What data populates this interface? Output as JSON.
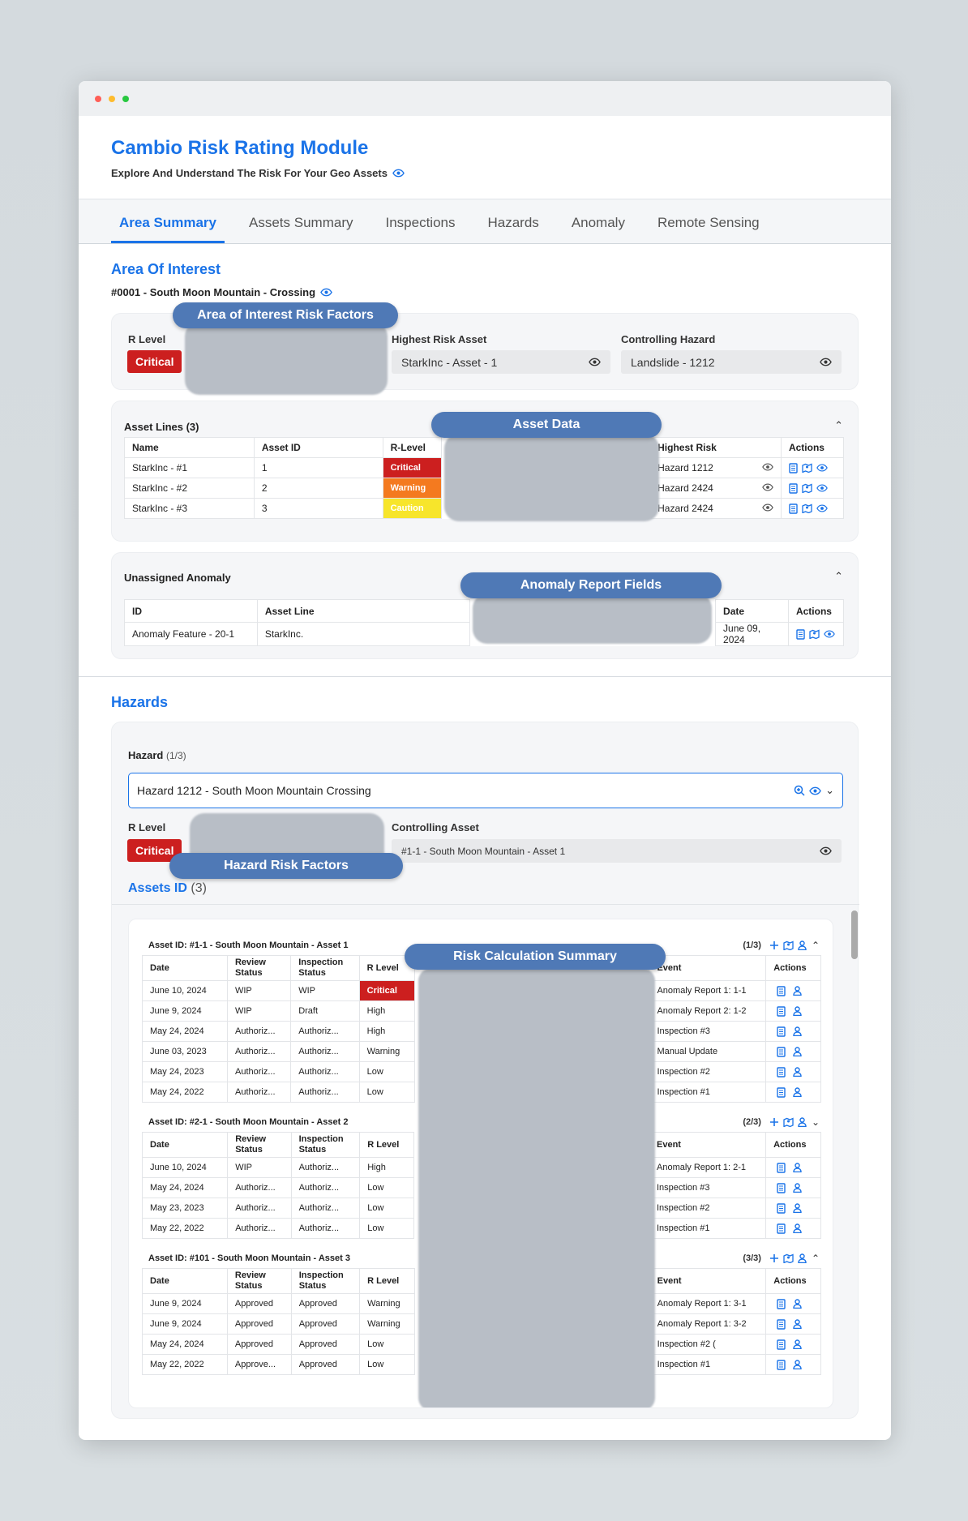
{
  "app": {
    "title": "Cambio Risk Rating Module",
    "subtitle": "Explore And Understand The Risk For Your Geo Assets"
  },
  "tabs": [
    "Area Summary",
    "Assets Summary",
    "Inspections",
    "Hazards",
    "Anomaly",
    "Remote Sensing"
  ],
  "aoi": {
    "heading": "Area Of Interest",
    "name": "#0001 - South Moon Mountain - Crossing",
    "r_level_label": "R Level",
    "r_level_value": "Critical",
    "highest_risk_asset_label": "Highest Risk Asset",
    "highest_risk_asset_value": "StarkInc - Asset - 1",
    "controlling_hazard_label": "Controlling Hazard",
    "controlling_hazard_value": "Landslide - 1212",
    "overlay": "Area of Interest Risk Factors"
  },
  "asset_lines": {
    "title": "Asset Lines (3)",
    "overlay": "Asset Data",
    "headers": [
      "Name",
      "Asset ID",
      "R-Level",
      "Highest Risk",
      "Actions"
    ],
    "rows": [
      {
        "name": "StarkInc - #1",
        "id": "1",
        "rlevel": "Critical",
        "highest": "Hazard 1212"
      },
      {
        "name": "StarkInc - #2",
        "id": "2",
        "rlevel": "Warning",
        "highest": "Hazard 2424"
      },
      {
        "name": "StarkInc - #3",
        "id": "3",
        "rlevel": "Caution",
        "highest": "Hazard 2424"
      }
    ]
  },
  "anomaly": {
    "title": "Unassigned Anomaly",
    "overlay": "Anomaly Report Fields",
    "headers": [
      "ID",
      "Asset Line",
      "Date",
      "Actions"
    ],
    "rows": [
      {
        "id": "Anomaly Feature - 20-1",
        "line": "StarkInc.",
        "date": "June 09, 2024"
      }
    ]
  },
  "hazards": {
    "heading": "Hazards",
    "hazard_label": "Hazard",
    "hazard_count": "(1/3)",
    "select_value": "Hazard 1212 - South Moon Mountain Crossing",
    "r_level_label": "R Level",
    "r_level_value": "Critical",
    "controlling_asset_label": "Controlling Asset",
    "controlling_asset_value": "#1-1 - South Moon Mountain - Asset 1",
    "overlay": "Hazard Risk Factors",
    "assets_id_label": "Assets ID",
    "assets_id_count": "(3)",
    "risk_overlay": "Risk Calculation Summary"
  },
  "asset_tables": [
    {
      "title": "Asset ID: #1-1 - South Moon Mountain - Asset 1",
      "count": "(1/3)",
      "expanded": true,
      "rows": [
        {
          "date": "June 10, 2024",
          "review": "WIP",
          "insp": "WIP",
          "rlevel": "Critical",
          "event": "Anomaly Report 1: 1-1"
        },
        {
          "date": "June 9, 2024",
          "review": "WIP",
          "insp": "Draft",
          "rlevel": "High",
          "event": "Anomaly Report 2: 1-2"
        },
        {
          "date": "May 24, 2024",
          "review": "Authoriz...",
          "insp": "Authoriz...",
          "rlevel": "High",
          "event": "Inspection #3"
        },
        {
          "date": "June 03, 2023",
          "review": "Authoriz...",
          "insp": "Authoriz...",
          "rlevel": "Warning",
          "event": "Manual Update"
        },
        {
          "date": "May 24, 2023",
          "review": "Authoriz...",
          "insp": "Authoriz...",
          "rlevel": "Low",
          "event": "Inspection #2"
        },
        {
          "date": "May 24, 2022",
          "review": "Authoriz...",
          "insp": "Authoriz...",
          "rlevel": "Low",
          "event": "Inspection #1"
        }
      ]
    },
    {
      "title": "Asset ID: #2-1 - South Moon Mountain - Asset 2",
      "count": "(2/3)",
      "expanded": false,
      "rows": [
        {
          "date": "June 10, 2024",
          "review": "WIP",
          "insp": "Authoriz...",
          "rlevel": "High",
          "event": "Anomaly Report 1: 2-1"
        },
        {
          "date": "May 24, 2024",
          "review": "Authoriz...",
          "insp": "Authoriz...",
          "rlevel": "Low",
          "event": "Inspection #3"
        },
        {
          "date": "May 23, 2023",
          "review": "Authoriz...",
          "insp": "Authoriz...",
          "rlevel": "Low",
          "event": "Inspection #2"
        },
        {
          "date": "May 22, 2022",
          "review": "Authoriz...",
          "insp": "Authoriz...",
          "rlevel": "Low",
          "event": "Inspection #1"
        }
      ]
    },
    {
      "title": "Asset ID: #101 - South Moon Mountain - Asset 3",
      "count": "(3/3)",
      "expanded": true,
      "rows": [
        {
          "date": "June 9, 2024",
          "review": "Approved",
          "insp": "Approved",
          "rlevel": "Warning",
          "event": "Anomaly Report 1: 3-1"
        },
        {
          "date": "June 9, 2024",
          "review": "Approved",
          "insp": "Approved",
          "rlevel": "Warning",
          "event": "Anomaly Report 1: 3-2"
        },
        {
          "date": "May 24, 2024",
          "review": "Approved",
          "insp": "Approved",
          "rlevel": "Low",
          "event": "Inspection #2 ("
        },
        {
          "date": "May 22, 2022",
          "review": "Approve...",
          "insp": "Approved",
          "rlevel": "Low",
          "event": "Inspection #1"
        }
      ]
    }
  ],
  "asset_table_headers": {
    "date": "Date",
    "review": "Review Status",
    "insp": "Inspection Status",
    "rlevel": "R Level",
    "event": "Event",
    "actions": "Actions"
  },
  "colors": {
    "accent": "#1a73e8",
    "critical": "#cc1f1f",
    "warning": "#f47a1f",
    "caution": "#f7e52b",
    "overlay": "#4f79b6"
  },
  "icons": [
    "eye-icon",
    "document-icon",
    "map-icon",
    "plus-icon",
    "user-icon",
    "zoom-icon",
    "chevron-up-icon",
    "chevron-down-icon"
  ]
}
